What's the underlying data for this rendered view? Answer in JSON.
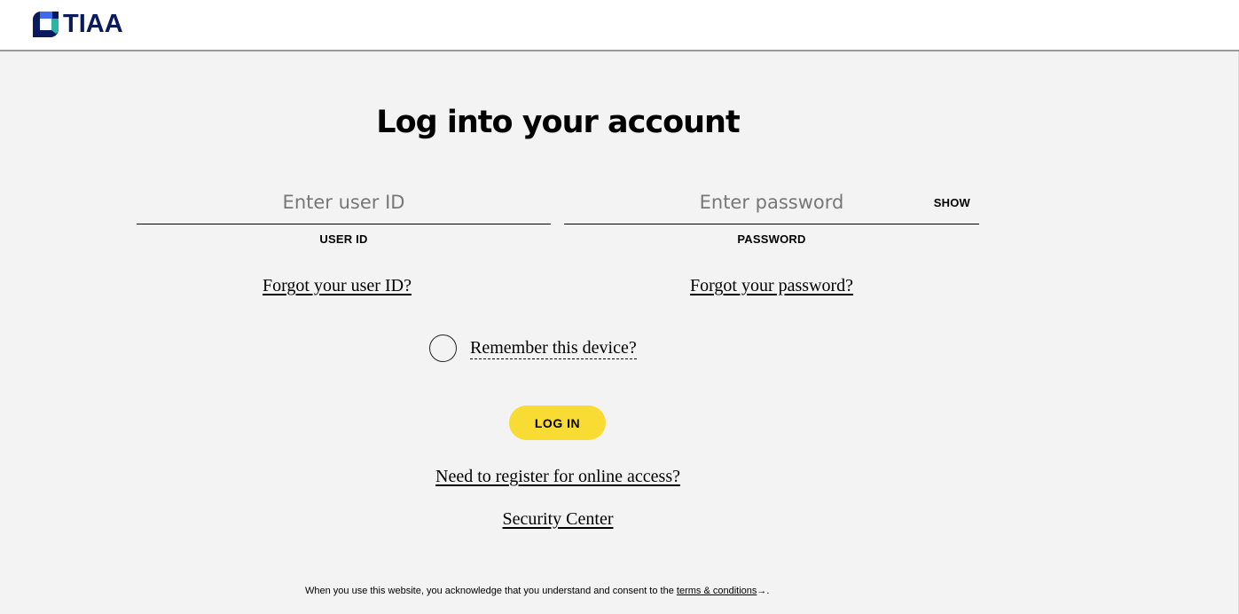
{
  "header": {
    "brand": "TIAA",
    "logo_colors": {
      "navy": "#0a1a5c",
      "blue": "#3f6ae8",
      "teal": "#2bb5a1"
    }
  },
  "main": {
    "title": "Log into your account",
    "user_id": {
      "placeholder": "Enter user ID",
      "value": "",
      "label": "USER ID"
    },
    "password": {
      "placeholder": "Enter password",
      "value": "",
      "label": "PASSWORD",
      "show_label": "SHOW"
    },
    "forgot_user_link": "Forgot your user ID?",
    "forgot_password_link": "Forgot your password?",
    "remember_device": {
      "label": "Remember this device?",
      "checked": false
    },
    "login_button": "LOG IN",
    "login_button_color": "#f8dc33",
    "register_link": "Need to register for online access?",
    "security_link": "Security Center"
  },
  "footer": {
    "text": "When you use this website, you acknowledge that you understand and consent to the ",
    "link": "terms & conditions",
    "link_icon": "external-link-icon",
    "suffix": "."
  }
}
